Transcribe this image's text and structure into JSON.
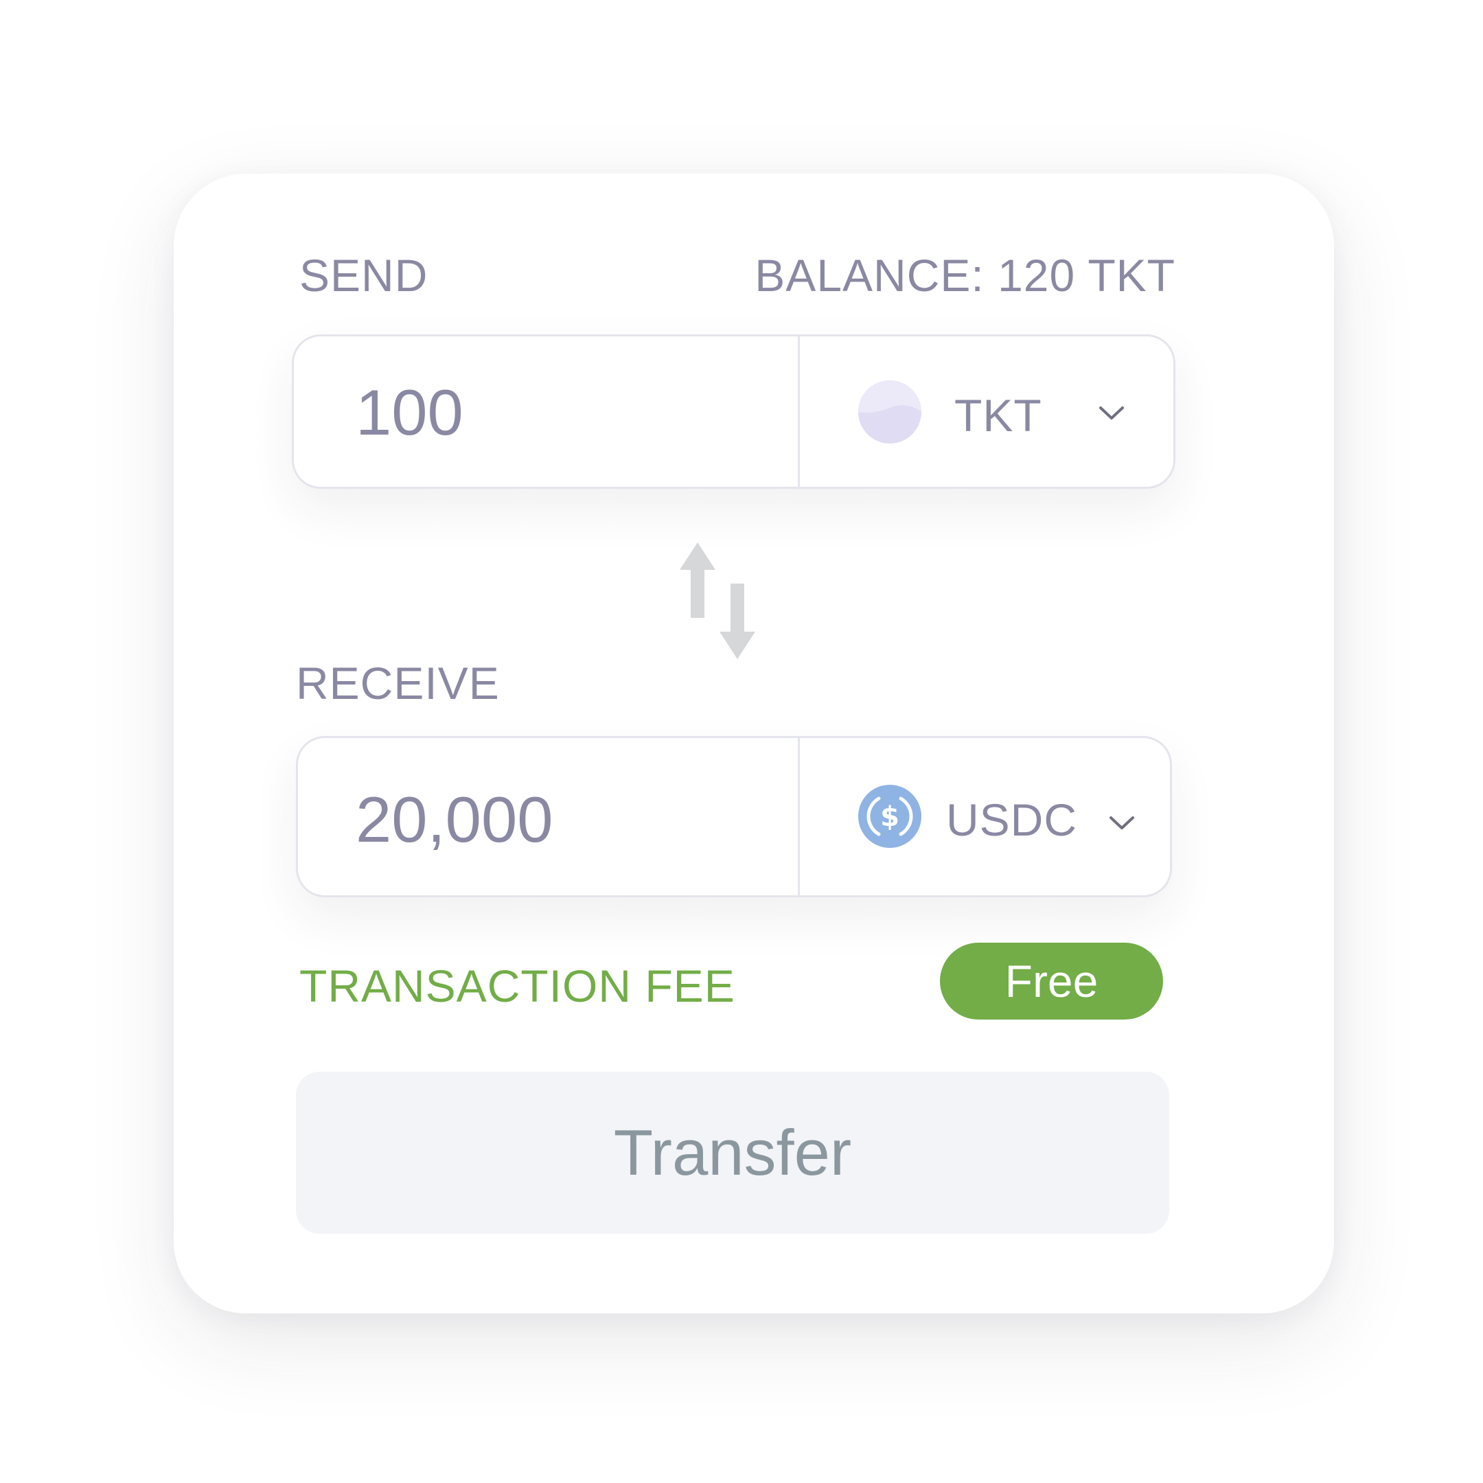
{
  "send": {
    "label": "SEND",
    "balance": "BALANCE: 120 TKT",
    "amount": "100",
    "token": "TKT",
    "token_icon": "tkt-coin-icon"
  },
  "swap_icon": "swap-arrows-icon",
  "receive": {
    "label": "RECEIVE",
    "amount": "20,000",
    "token": "USDC",
    "token_icon": "usdc-coin-icon"
  },
  "fee": {
    "label": "TRANSACTION FEE",
    "value": "Free"
  },
  "transfer_button": "Transfer",
  "colors": {
    "text_muted": "#8a89a3",
    "accent_green": "#72ad47",
    "border": "#e4e5ec",
    "button_bg": "#f3f4f7",
    "button_text": "#8b979f",
    "usdc_blue": "#8fb3e3",
    "tkt_lavender": "#e0dcf4",
    "swap_gray": "#d6d7d9"
  }
}
